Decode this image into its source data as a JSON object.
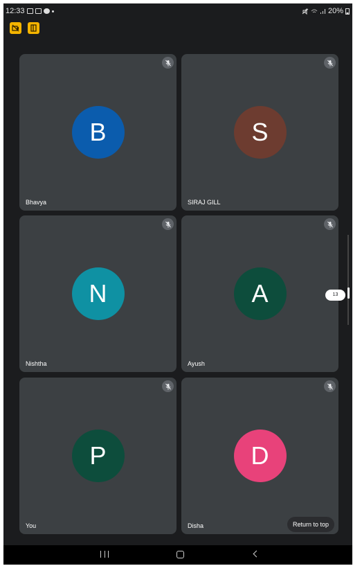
{
  "status_bar": {
    "time": "12:33",
    "battery": "20%"
  },
  "participants": [
    {
      "name": "Bhavya",
      "initial": "B",
      "color": "#0b5cad"
    },
    {
      "name": "SIRAJ GILL",
      "initial": "S",
      "color": "#6d3c30"
    },
    {
      "name": "Nishtha",
      "initial": "N",
      "color": "#0f91a3"
    },
    {
      "name": "Ayush",
      "initial": "A",
      "color": "#0d4d3c"
    },
    {
      "name": "You",
      "initial": "P",
      "color": "#0d4d3c"
    },
    {
      "name": "Disha",
      "initial": "D",
      "color": "#e8427a"
    }
  ],
  "page_indicator": "13",
  "return_to_top_label": "Return to top",
  "accent_color": "#f4b400"
}
